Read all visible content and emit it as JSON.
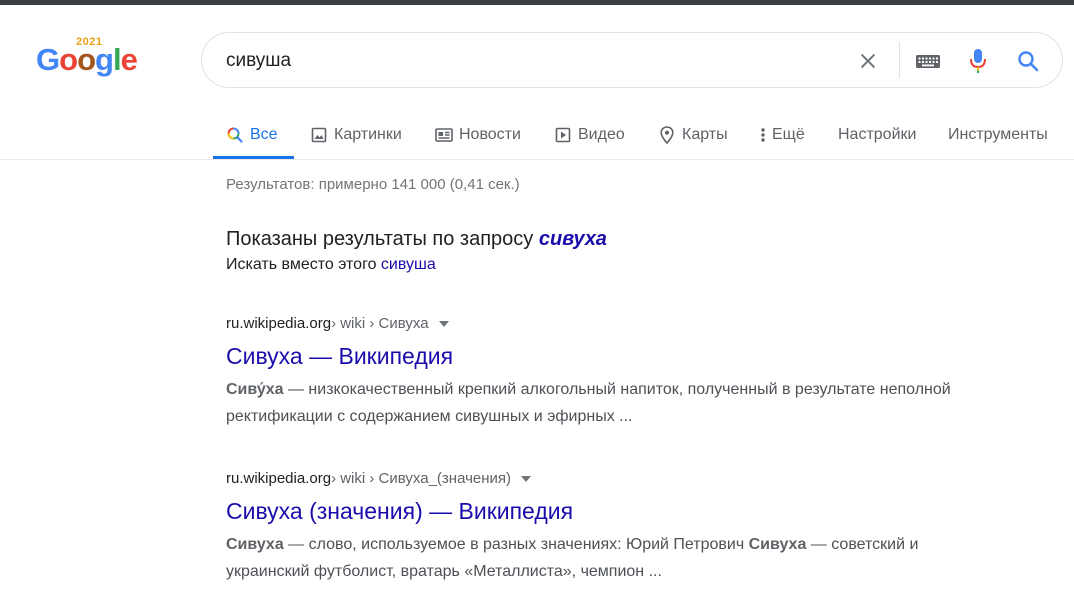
{
  "logo": {
    "year": "2021",
    "letters": [
      "G",
      "o",
      "o",
      "g",
      "l",
      "e"
    ]
  },
  "search": {
    "query": "сивуша"
  },
  "tabs": [
    {
      "label": "Все",
      "icon": "search-icon"
    },
    {
      "label": "Картинки",
      "icon": "image-icon"
    },
    {
      "label": "Новости",
      "icon": "news-icon"
    },
    {
      "label": "Видео",
      "icon": "video-icon"
    },
    {
      "label": "Карты",
      "icon": "map-pin-icon"
    },
    {
      "label": "Ещё",
      "icon": "more-vert-icon"
    },
    {
      "label": "Настройки"
    },
    {
      "label": "Инструменты"
    }
  ],
  "stats": "Результатов: примерно 141 000 (0,41 сек.)",
  "spell": {
    "showing_prefix": "Показаны результаты по запросу ",
    "corrected": "сивуха",
    "instead_prefix": "Искать вместо этого ",
    "original": "сивуша"
  },
  "results": [
    {
      "domain": "ru.wikipedia.org",
      "path": " › wiki › Сивуха",
      "title": "Сивуха — Википедия",
      "snippet_bold": "Сиву́ха",
      "snippet_rest": " — низкокачественный крепкий алкогольный напиток, полученный в результате неполной ректификации с содержанием сивушных и эфирных ..."
    },
    {
      "domain": "ru.wikipedia.org",
      "path": " › wiki › Сивуха_(значения)",
      "title": "Сивуха (значения) — Википедия",
      "snippet_bold": "Сивуха",
      "snippet_mid": " — слово, используемое в разных значениях: Юрий Петрович ",
      "snippet_bold2": "Сивуха",
      "snippet_rest": " — советский и украинский футболист, вратарь «Металлиста», чемпион ..."
    }
  ],
  "colors": {
    "link": "#1a0dab",
    "accent": "#1a73e8",
    "muted": "#70757a"
  }
}
